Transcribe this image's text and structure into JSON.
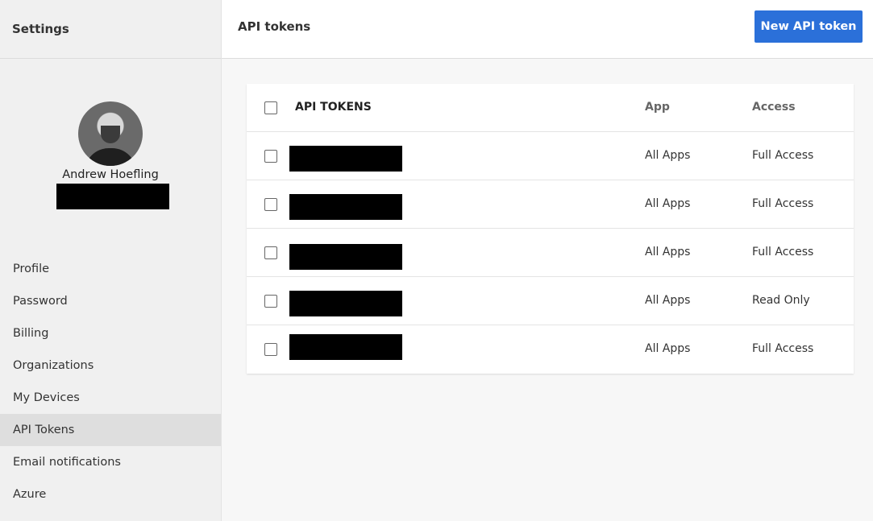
{
  "sidebar": {
    "title": "Settings",
    "profile": {
      "name": "Andrew Hoefling"
    },
    "nav": [
      {
        "label": "Profile",
        "active": false
      },
      {
        "label": "Password",
        "active": false
      },
      {
        "label": "Billing",
        "active": false
      },
      {
        "label": "Organizations",
        "active": false
      },
      {
        "label": "My Devices",
        "active": false
      },
      {
        "label": "API Tokens",
        "active": true
      },
      {
        "label": "Email notifications",
        "active": false
      },
      {
        "label": "Azure",
        "active": false
      }
    ]
  },
  "header": {
    "title": "API tokens",
    "new_token_label": "New API token"
  },
  "table": {
    "columns": {
      "name": "API TOKENS",
      "app": "App",
      "access": "Access"
    },
    "rows": [
      {
        "app": "All Apps",
        "access": "Full Access"
      },
      {
        "app": "All Apps",
        "access": "Full Access"
      },
      {
        "app": "All Apps",
        "access": "Full Access"
      },
      {
        "app": "All Apps",
        "access": "Read Only"
      },
      {
        "app": "All Apps",
        "access": "Full Access"
      }
    ]
  },
  "colors": {
    "accent": "#2b70d9",
    "sidebar_bg": "#f0f0f0",
    "active_nav_bg": "#dedede"
  }
}
